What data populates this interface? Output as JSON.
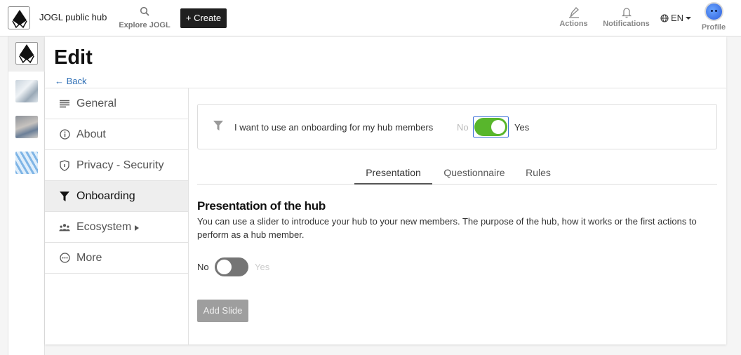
{
  "topbar": {
    "brand": "JOGL public hub",
    "explore_label": "Explore JOGL",
    "create_label": "+ Create",
    "actions_label": "Actions",
    "notifications_label": "Notifications",
    "language": "EN",
    "profile_label": "Profile"
  },
  "page": {
    "title": "Edit",
    "back_label": "← Back"
  },
  "nav": {
    "items": [
      {
        "label": "General",
        "icon": "lines-icon"
      },
      {
        "label": "About",
        "icon": "info-icon"
      },
      {
        "label": "Privacy - Security",
        "icon": "shield-icon"
      },
      {
        "label": "Onboarding",
        "icon": "filter-icon",
        "active": true
      },
      {
        "label": "Ecosystem",
        "icon": "people-icon"
      },
      {
        "label": "More",
        "icon": "more-icon"
      }
    ]
  },
  "onboarding": {
    "question": "I want to use an onboarding for my hub members",
    "no_label": "No",
    "yes_label": "Yes",
    "enabled": true
  },
  "tabs": [
    {
      "label": "Presentation",
      "active": true
    },
    {
      "label": "Questionnaire"
    },
    {
      "label": "Rules"
    }
  ],
  "presentation": {
    "title": "Presentation of the hub",
    "description": "You can use a slider to introduce your hub to your new members. The purpose of the hub, how it works or the first actions to perform as a hub member.",
    "no_label": "No",
    "yes_label": "Yes",
    "slider_enabled": false,
    "add_slide_label": "Add Slide"
  },
  "colors": {
    "accent": "#58b62c",
    "link": "#2f6fb5",
    "dark_button": "#1f1f1f"
  }
}
